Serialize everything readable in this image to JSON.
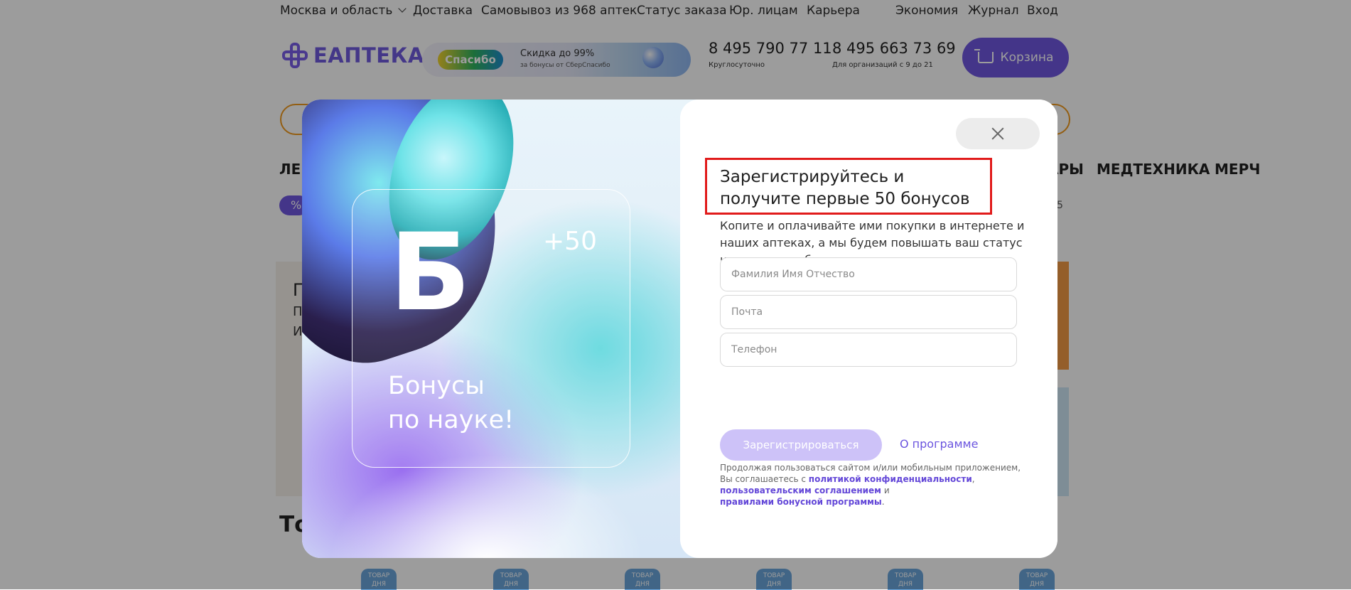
{
  "topnav": {
    "region": "Москва и область",
    "delivery": "Доставка",
    "pickup": "Самовывоз из 968 аптек",
    "order_status": "Статус заказа",
    "legal_entities": "Юр. лицам",
    "career": "Карьера",
    "economy": "Экономия",
    "journal": "Журнал",
    "login": "Вход"
  },
  "header": {
    "logo_text": "ЕАПТЕКА",
    "promo": {
      "sber_label": "Спасибо",
      "line1": "Скидка до 99%",
      "line2": "за бонусы от СберСпасибо"
    },
    "phone1": {
      "number": "8 495 790 77 11",
      "note": "Круглосуточно"
    },
    "phone2": {
      "number": "8 495 663 73 69",
      "note": "Для организаций с 9 до 21"
    },
    "cart_label": "Корзина"
  },
  "catnav": {
    "left_fragment": "ЛЕ",
    "item_a": "АРЫ",
    "item_b": "МЕДТЕХНИКА",
    "item_c": "МЕРЧ",
    "chip_symbol": "%",
    "right_digit": "5"
  },
  "background": {
    "banner_fragments": [
      "П",
      "П",
      "И"
    ],
    "heading_fragment": "То",
    "badge_text": "ТОВАР ДНЯ"
  },
  "modal": {
    "art": {
      "letter": "Б",
      "bonus": "+50",
      "caption_line1": "Бонусы",
      "caption_line2": "по науке!"
    },
    "title": "Зарегистрируйтесь и получите первые 50 бонусов",
    "description": "Копите и оплачивайте ими покупки в интернете и наших аптеках, а мы будем повышать ваш статус и предлагать больше скидок.",
    "fields": {
      "name_placeholder": "Фамилия Имя Отчество",
      "email_placeholder": "Почта",
      "phone_placeholder": "Телефон"
    },
    "register_label": "Зарегистрироваться",
    "about_link": "О программе",
    "legal": {
      "text1": "Продолжая пользоваться сайтом и/или мобильным приложением, Вы соглашаетесь с ",
      "link1": "политикой конфиденциальности",
      "sep1": ", ",
      "link2": "пользовательским соглашением",
      "sep2": " и ",
      "link3": "правилами бонусной программы",
      "end": "."
    }
  },
  "colors": {
    "accent": "#6f58e0",
    "highlight_border": "#e11b1b",
    "button_disabled": "#cdc2f8",
    "search_border": "#f19a1e"
  }
}
